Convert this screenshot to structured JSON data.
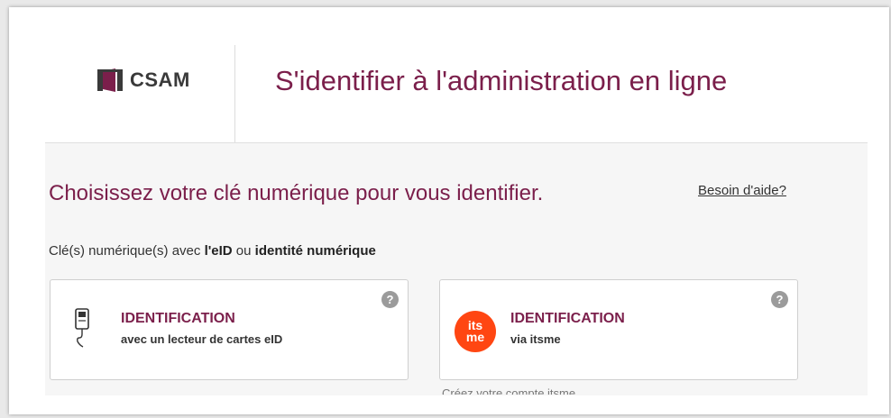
{
  "header": {
    "logo_text": "CSAM",
    "title": "S'identifier à l'administration en ligne"
  },
  "main": {
    "subtitle": "Choisissez votre clé numérique pour vous identifier.",
    "help_link": "Besoin d'aide?",
    "section_label": {
      "prefix": "Clé(s) numérique(s) avec ",
      "bold1": "l'eID",
      "middle": " ou ",
      "bold2": "identité numérique"
    },
    "cards": [
      {
        "title": "IDENTIFICATION",
        "subtitle": "avec un lecteur de cartes eID",
        "icon": "card-reader-icon"
      },
      {
        "title": "IDENTIFICATION",
        "subtitle": "via itsme",
        "icon": "itsme-logo-icon"
      }
    ],
    "help_icon_glyph": "?",
    "itsme_icon_text": {
      "line1": "its",
      "line2": "me"
    },
    "cut_text": "Créez votre compte itsme"
  },
  "colors": {
    "brand": "#7b1f4b",
    "itsme_orange": "#ff4612"
  }
}
